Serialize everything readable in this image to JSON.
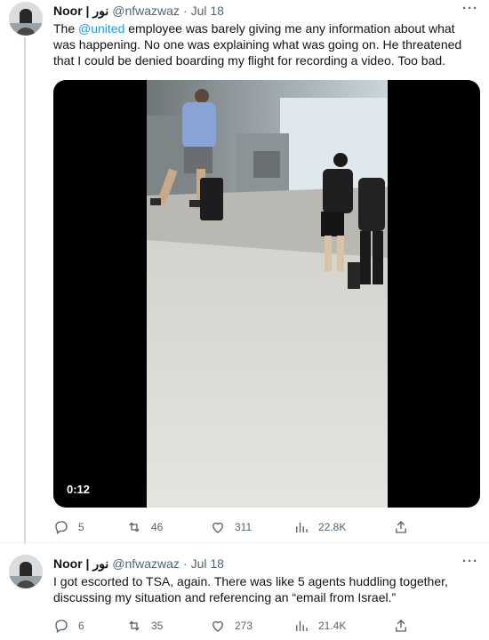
{
  "tweets": [
    {
      "author_name": "Noor | نور",
      "author_handle": "@nfwazwaz",
      "date": "Jul 18",
      "more": "···",
      "text_before": "The ",
      "mention": "@united",
      "text_after": " employee was barely giving me any information about what was happening. No one was explaining what was going on. He threatened that I could be denied boarding my flight for recording a video. Too bad.",
      "video_duration": "0:12",
      "replies": "5",
      "retweets": "46",
      "likes": "311",
      "views": "22.8K"
    },
    {
      "author_name": "Noor | نور",
      "author_handle": "@nfwazwaz",
      "date": "Jul 18",
      "more": "···",
      "text": "I got escorted to TSA, again. There was like 5 agents huddling together, discussing my situation and referencing an “email from Israel.”",
      "replies": "6",
      "retweets": "35",
      "likes": "273",
      "views": "21.4K"
    }
  ],
  "separator": "·",
  "icons": [
    "reply-icon",
    "retweet-icon",
    "like-icon",
    "views-icon",
    "share-icon"
  ],
  "colors": {
    "link": "#1d9bf0",
    "secondary": "#536471",
    "text": "#0f1419"
  }
}
